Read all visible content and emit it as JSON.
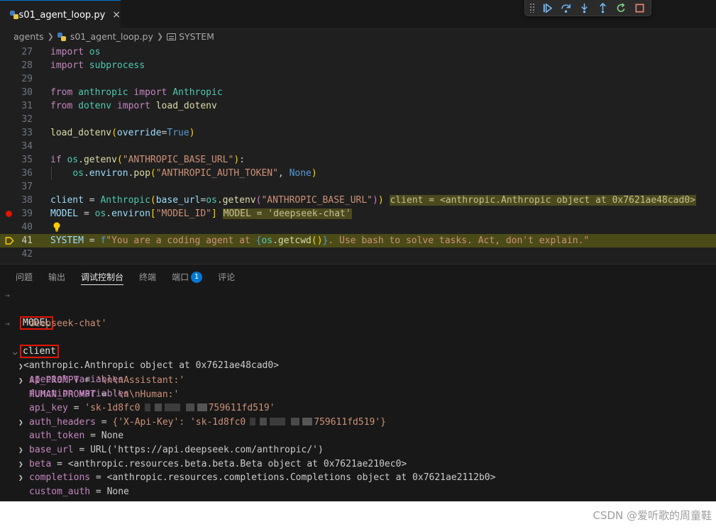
{
  "tab": {
    "filename": "s01_agent_loop.py",
    "close_icon": "×"
  },
  "breadcrumb": {
    "folder": "agents",
    "file": "s01_agent_loop.py",
    "symbol": "SYSTEM"
  },
  "code": {
    "lines": [
      {
        "num": "27",
        "tokens": [
          [
            "kw",
            "import"
          ],
          [
            "pl",
            " "
          ],
          [
            "cls",
            "os"
          ]
        ]
      },
      {
        "num": "28",
        "tokens": [
          [
            "kw",
            "import"
          ],
          [
            "pl",
            " "
          ],
          [
            "cls",
            "subprocess"
          ]
        ]
      },
      {
        "num": "29",
        "tokens": []
      },
      {
        "num": "30",
        "tokens": [
          [
            "kw",
            "from"
          ],
          [
            "pl",
            " "
          ],
          [
            "cls",
            "anthropic"
          ],
          [
            "pl",
            " "
          ],
          [
            "kw",
            "import"
          ],
          [
            "pl",
            " "
          ],
          [
            "cls",
            "Anthropic"
          ]
        ]
      },
      {
        "num": "31",
        "tokens": [
          [
            "kw",
            "from"
          ],
          [
            "pl",
            " "
          ],
          [
            "cls",
            "dotenv"
          ],
          [
            "pl",
            " "
          ],
          [
            "kw",
            "import"
          ],
          [
            "pl",
            " "
          ],
          [
            "fn",
            "load_dotenv"
          ]
        ]
      },
      {
        "num": "32",
        "tokens": []
      },
      {
        "num": "33",
        "tokens": [
          [
            "fn",
            "load_dotenv"
          ],
          [
            "br1",
            "("
          ],
          [
            "var",
            "override"
          ],
          [
            "pl",
            "="
          ],
          [
            "kb",
            "True"
          ],
          [
            "br1",
            ")"
          ]
        ]
      },
      {
        "num": "34",
        "tokens": []
      },
      {
        "num": "35",
        "tokens": [
          [
            "kw",
            "if"
          ],
          [
            "pl",
            " "
          ],
          [
            "cls",
            "os"
          ],
          [
            "pl",
            "."
          ],
          [
            "fn",
            "getenv"
          ],
          [
            "br1",
            "("
          ],
          [
            "str",
            "\"ANTHROPIC_BASE_URL\""
          ],
          [
            "br1",
            ")"
          ],
          [
            "pl",
            ":"
          ]
        ]
      },
      {
        "num": "36",
        "tokens": [
          [
            "pl",
            "    "
          ],
          [
            "cls",
            "os"
          ],
          [
            "pl",
            "."
          ],
          [
            "var",
            "environ"
          ],
          [
            "pl",
            "."
          ],
          [
            "fn",
            "pop"
          ],
          [
            "br1",
            "("
          ],
          [
            "str",
            "\"ANTHROPIC_AUTH_TOKEN\""
          ],
          [
            "pl",
            ", "
          ],
          [
            "kb",
            "None"
          ],
          [
            "br1",
            ")"
          ]
        ]
      },
      {
        "num": "37",
        "tokens": []
      },
      {
        "num": "38",
        "tokens": [
          [
            "var",
            "client"
          ],
          [
            "pl",
            " = "
          ],
          [
            "cls",
            "Anthropic"
          ],
          [
            "br1",
            "("
          ],
          [
            "var",
            "base_url"
          ],
          [
            "pl",
            "="
          ],
          [
            "cls",
            "os"
          ],
          [
            "pl",
            "."
          ],
          [
            "fn",
            "getenv"
          ],
          [
            "br2",
            "("
          ],
          [
            "str",
            "\"ANTHROPIC_BASE_URL\""
          ],
          [
            "br2",
            ")"
          ],
          [
            "br1",
            ")"
          ],
          [
            "pl",
            " "
          ],
          [
            "inline",
            "client = <anthropic.Anthropic object at 0x7621ae48cad0>"
          ]
        ]
      },
      {
        "num": "39",
        "tokens": [
          [
            "var",
            "MODEL"
          ],
          [
            "pl",
            " = "
          ],
          [
            "cls",
            "os"
          ],
          [
            "pl",
            "."
          ],
          [
            "var",
            "environ"
          ],
          [
            "br1",
            "["
          ],
          [
            "str",
            "\"MODEL_ID\""
          ],
          [
            "br1",
            "]"
          ],
          [
            "pl",
            " "
          ],
          [
            "inline",
            "MODEL = 'deepseek-chat'"
          ]
        ]
      },
      {
        "num": "40",
        "tokens": []
      },
      {
        "num": "41",
        "tokens": [
          [
            "var",
            "SYSTEM"
          ],
          [
            "pl",
            " = "
          ],
          [
            "kb",
            "f"
          ],
          [
            "str",
            "\"You are a coding agent at "
          ],
          [
            "kb",
            "{"
          ],
          [
            "cls",
            "os"
          ],
          [
            "pl",
            "."
          ],
          [
            "fn",
            "getcwd"
          ],
          [
            "br1",
            "()"
          ],
          [
            "kb",
            "}"
          ],
          [
            "str",
            ". Use bash to solve tasks. Act, don't explain.\""
          ]
        ]
      },
      {
        "num": "42",
        "tokens": []
      }
    ]
  },
  "panel": {
    "tabs": [
      {
        "label": "问题"
      },
      {
        "label": "输出"
      },
      {
        "label": "调试控制台"
      },
      {
        "label": "终端"
      },
      {
        "label": "端口",
        "badge": "1"
      },
      {
        "label": "评论"
      }
    ],
    "console": {
      "input1": "MODEL",
      "output1": "'deepseek-chat'",
      "input2": "client",
      "object_header": "<anthropic.Anthropic object at 0x7621ae48cad0>",
      "special_vars": "special variables",
      "function_vars": "function variables",
      "props": [
        {
          "name": "AI_PROMPT",
          "value": "'\\n\\nAssistant:'",
          "expandable": false
        },
        {
          "name": "HUMAN_PROMPT",
          "value": "'\\n\\nHuman:'",
          "expandable": false
        },
        {
          "name": "api_key",
          "value_start": "'sk-1d8fc0",
          "value_end": "759611fd519'",
          "expandable": false,
          "redacted": true
        },
        {
          "name": "auth_headers",
          "value_start": "{'X-Api-Key': 'sk-1d8fc0",
          "value_end": "759611fd519'}",
          "expandable": true,
          "redacted": true
        },
        {
          "name": "auth_token",
          "value": "None",
          "expandable": false
        },
        {
          "name": "base_url",
          "value": "URL('https://api.deepseek.com/anthropic/')",
          "expandable": true
        },
        {
          "name": "beta",
          "value": "<anthropic.resources.beta.beta.Beta object at 0x7621ae210ec0>",
          "expandable": true
        },
        {
          "name": "completions",
          "value": "<anthropic.resources.completions.Completions object at 0x7621ae2112b0>",
          "expandable": true
        },
        {
          "name": "custom_auth",
          "value": "None",
          "expandable": false
        }
      ]
    }
  },
  "watermark": "CSDN @爱听歌的周童鞋",
  "colors": {
    "accent": "#0078d4",
    "breakpoint": "#e51400",
    "highlight_box": "#e51400",
    "current_line": "#4b4b18"
  }
}
